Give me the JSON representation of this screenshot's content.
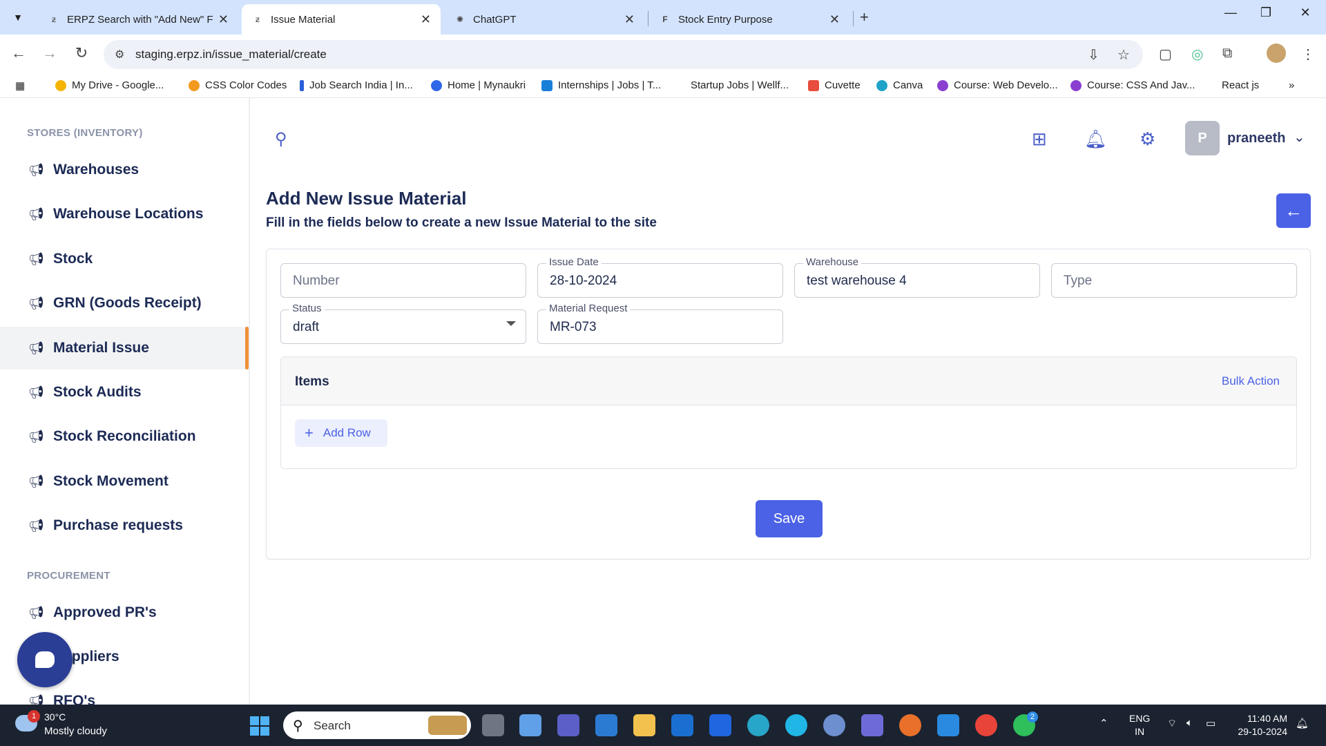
{
  "browser": {
    "tabs": [
      {
        "title": "ERPZ Search with \"Add New\" Fu",
        "icon": "erpz-icon"
      },
      {
        "title": "Issue Material",
        "icon": "erpz-icon"
      },
      {
        "title": "ChatGPT",
        "icon": "chatgpt-icon"
      },
      {
        "title": "Stock Entry Purpose",
        "icon": "f-icon"
      }
    ],
    "url": "staging.erpz.in/issue_material/create",
    "bookmarks": [
      "My Drive - Google...",
      "CSS Color Codes",
      "Job Search India | In...",
      "Home | Mynaukri",
      "Internships | Jobs | T...",
      "Startup Jobs | Wellf...",
      "Cuvette",
      "Canva",
      "Course: Web Develo...",
      "Course: CSS And Jav...",
      "React js"
    ]
  },
  "sidebar": {
    "stores_label": "STORES (INVENTORY)",
    "items": [
      {
        "label": "Warehouses"
      },
      {
        "label": "Warehouse Locations"
      },
      {
        "label": "Stock"
      },
      {
        "label": "GRN (Goods Receipt)"
      },
      {
        "label": "Material Issue"
      },
      {
        "label": "Stock Audits"
      },
      {
        "label": "Stock Reconciliation"
      },
      {
        "label": "Stock Movement"
      },
      {
        "label": "Purchase requests"
      }
    ],
    "procurement_label": "PROCUREMENT",
    "procurement_items": [
      {
        "label": "Approved PR's"
      },
      {
        "label": "Suppliers"
      },
      {
        "label": "RFQ's"
      }
    ]
  },
  "header": {
    "user_initial": "P",
    "user_name": "praneeth"
  },
  "page": {
    "title": "Add New Issue Material",
    "subtitle": "Fill in the fields below to create a new Issue Material to the site"
  },
  "form": {
    "number": {
      "placeholder": "Number"
    },
    "issue_date": {
      "label": "Issue Date",
      "value": "28-10-2024"
    },
    "warehouse": {
      "label": "Warehouse",
      "value": "test warehouse 4"
    },
    "type": {
      "placeholder": "Type"
    },
    "status": {
      "label": "Status",
      "value": "draft"
    },
    "material_request": {
      "label": "Material Request",
      "value": "MR-073"
    }
  },
  "items": {
    "title": "Items",
    "bulk_action": "Bulk Action",
    "add_row": "Add Row"
  },
  "save_label": "Save",
  "taskbar": {
    "weather_temp": "30°C",
    "weather_cond": "Mostly cloudy",
    "weather_badge": "1",
    "search_label": "Search",
    "whatsapp_badge": "2",
    "lang_1": "ENG",
    "lang_2": "IN",
    "time": "11:40 AM",
    "date": "29-10-2024"
  },
  "colors": {
    "accent": "#4b62e6",
    "active_indicator": "#f0913a",
    "nav_text": "#1c2a55"
  }
}
